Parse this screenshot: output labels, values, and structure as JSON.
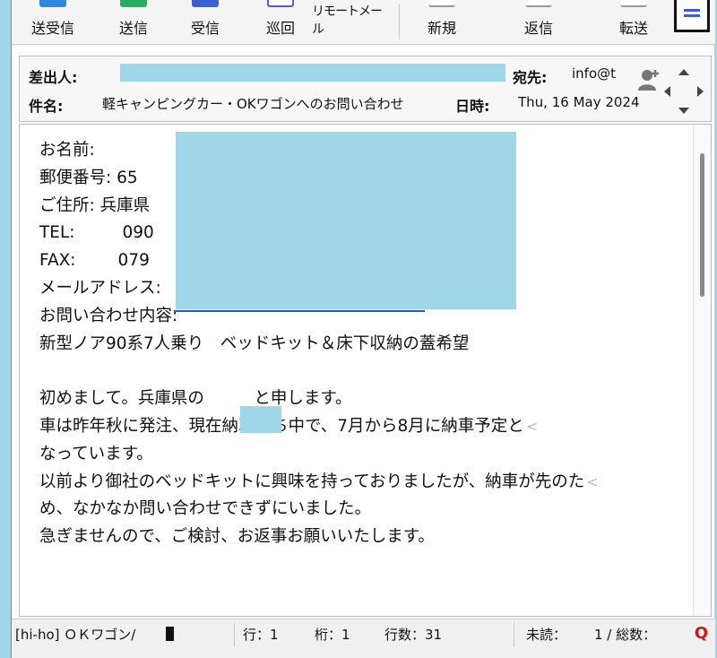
{
  "toolbar": {
    "buttons": [
      {
        "label": "送受信",
        "icon": "send-receive-icon",
        "color": "#2e86de"
      },
      {
        "label": "送信",
        "icon": "send-icon",
        "color": "#27ae60"
      },
      {
        "label": "受信",
        "icon": "receive-icon",
        "color": "#3b5fd0"
      },
      {
        "label": "巡回",
        "icon": "patrol-icon",
        "color": "#5a5acd"
      },
      {
        "label": "リモートメール",
        "icon": "remote-mail-icon",
        "color": "#888888"
      },
      {
        "label": "新規",
        "icon": "new-mail-icon",
        "color": "#888888"
      },
      {
        "label": "返信",
        "icon": "reply-icon",
        "color": "#888888"
      },
      {
        "label": "転送",
        "icon": "forward-icon",
        "color": "#888888"
      }
    ]
  },
  "header": {
    "from_label": "差出人:",
    "to_label": "宛先:",
    "to_value": "info@t",
    "subject_label": "件名:",
    "subject_value": "軽キャンピングカー・OKワゴンへのお問い合わせ",
    "date_label": "日時:",
    "date_value": "Thu, 16 May 2024"
  },
  "body": {
    "lines": [
      {
        "text": "お名前:",
        "wrap": false
      },
      {
        "text": "郵便番号: 65",
        "wrap": false
      },
      {
        "text": "ご住所: 兵庫県",
        "wrap": false
      },
      {
        "text": "TEL:         090",
        "wrap": false
      },
      {
        "text": "FAX:        079",
        "wrap": false
      },
      {
        "text": "メールアドレス:",
        "wrap": false
      },
      {
        "text": "お問い合わせ内容:",
        "wrap": false
      },
      {
        "text": "新型ノア90系7人乗り　ベッドキット＆床下収納の蓋希望",
        "wrap": false
      },
      {
        "text": "",
        "wrap": false
      },
      {
        "text": "初めまして。兵庫県の　　　と申します。",
        "wrap": false
      },
      {
        "text": "車は昨年秋に発注、現在納車待ち中で、7月から8月に納車予定と",
        "wrap": true
      },
      {
        "text": "なっています。",
        "wrap": false
      },
      {
        "text": "以前より御社のベッドキットに興味を持っておりましたが、納車が先のた",
        "wrap": true
      },
      {
        "text": "め、なかなか問い合わせできずにいました。",
        "wrap": false
      },
      {
        "text": "急ぎませんので、ご検討、お返事お願いいたします。",
        "wrap": false
      }
    ],
    "wrap_mark": "<"
  },
  "statusbar": {
    "account": "[hi-ho] ＯＫワゴン/",
    "row": "行：1",
    "col": "桁：1",
    "lines": "行数：31",
    "unread": "未読：",
    "total": "1 / 総数：",
    "q": "Q"
  }
}
